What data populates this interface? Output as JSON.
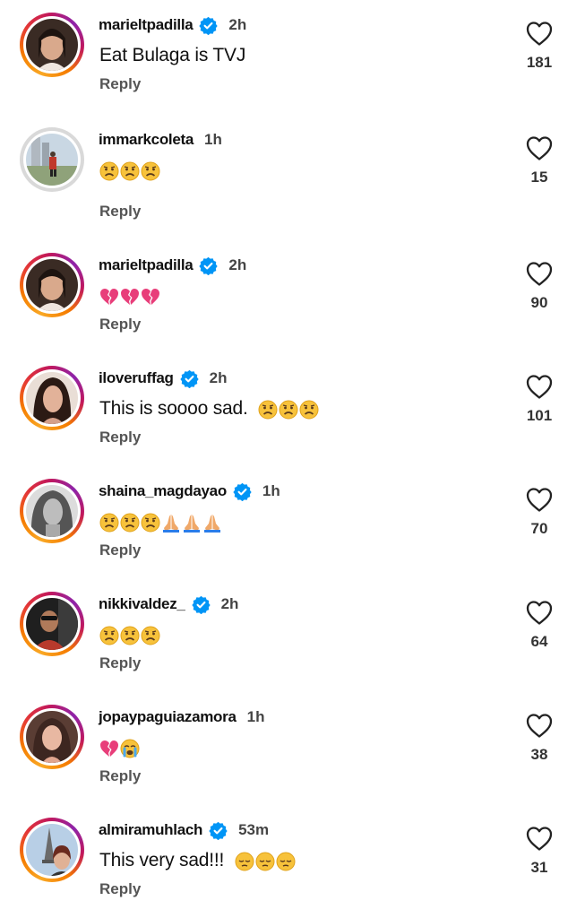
{
  "comments": [
    {
      "username": "marieltpadilla",
      "verified": true,
      "time": "2h",
      "text": "Eat Bulaga is TVJ",
      "emojis": [],
      "reply": "Reply",
      "likes": "181"
    },
    {
      "username": "immarkcoleta",
      "verified": false,
      "time": "1h",
      "text": "",
      "emojis": [
        "sad-face",
        "sad-face",
        "sad-face"
      ],
      "reply": "Reply",
      "likes": "15"
    },
    {
      "username": "marieltpadilla",
      "verified": true,
      "time": "2h",
      "text": "",
      "emojis": [
        "broken-heart",
        "broken-heart",
        "broken-heart"
      ],
      "reply": "Reply",
      "likes": "90"
    },
    {
      "username": "iloveruffag",
      "verified": true,
      "time": "2h",
      "text": "This is soooo sad.",
      "emojis": [
        "sad-face",
        "sad-face",
        "sad-face"
      ],
      "reply": "Reply",
      "likes": "101"
    },
    {
      "username": "shaina_magdayao",
      "verified": true,
      "time": "1h",
      "text": "",
      "emojis": [
        "sad-face",
        "sad-face",
        "sad-face",
        "praying-hands",
        "praying-hands",
        "praying-hands"
      ],
      "reply": "Reply",
      "likes": "70"
    },
    {
      "username": "nikkivaldez_",
      "verified": true,
      "time": "2h",
      "text": "",
      "emojis": [
        "sad-face",
        "sad-face",
        "sad-face"
      ],
      "reply": "Reply",
      "likes": "64"
    },
    {
      "username": "jopaypaguiazamora",
      "verified": false,
      "time": "1h",
      "text": "",
      "emojis": [
        "broken-heart",
        "crying-face"
      ],
      "reply": "Reply",
      "likes": "38"
    },
    {
      "username": "almiramuhlach",
      "verified": true,
      "time": "53m",
      "text": "This very sad!!!",
      "emojis": [
        "pensive-face",
        "pensive-face",
        "pensive-face"
      ],
      "reply": "Reply",
      "likes": "31"
    }
  ],
  "colors": {
    "verified": "#0095f6",
    "text": "#111111",
    "muted": "#555555"
  }
}
